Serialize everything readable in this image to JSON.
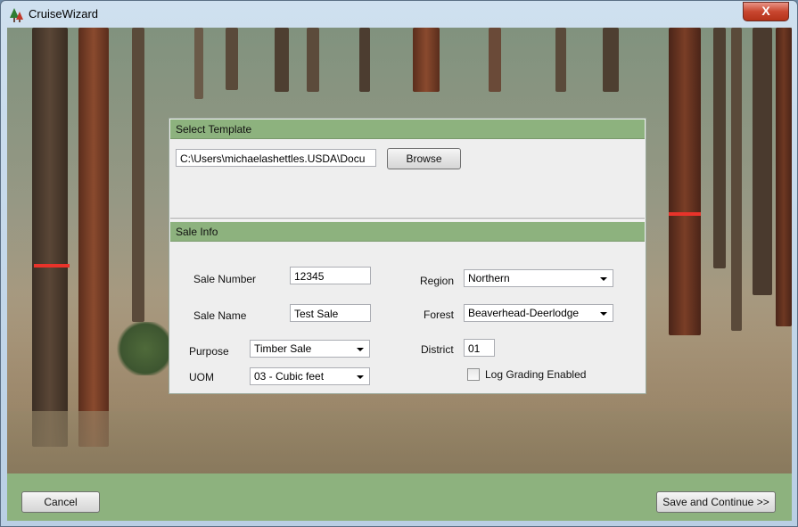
{
  "window": {
    "title": "CruiseWizard",
    "close_label": "X"
  },
  "template": {
    "header": "Select Template",
    "path_value": "C:\\Users\\michaelashettles.USDA\\Docu",
    "browse_label": "Browse"
  },
  "sale_info": {
    "header": "Sale Info",
    "sale_number_label": "Sale Number",
    "sale_number_value": "12345",
    "sale_name_label": "Sale Name",
    "sale_name_value": "Test Sale",
    "purpose_label": "Purpose",
    "purpose_value": "Timber Sale",
    "uom_label": "UOM",
    "uom_value": "03 - Cubic feet",
    "region_label": "Region",
    "region_value": "Northern",
    "forest_label": "Forest",
    "forest_value": "Beaverhead-Deerlodge",
    "district_label": "District",
    "district_value": "01",
    "log_grading_label": "Log Grading Enabled",
    "log_grading_checked": false
  },
  "footer": {
    "cancel_label": "Cancel",
    "save_label": "Save and Continue >>"
  },
  "colors": {
    "accent_green": "#8db27e",
    "close_red": "#c8462f"
  }
}
